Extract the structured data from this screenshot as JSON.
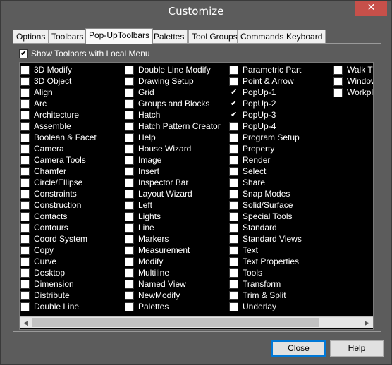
{
  "window": {
    "title": "Customize",
    "close_glyph": "✕"
  },
  "tabs": [
    {
      "label": "Options",
      "key": "O"
    },
    {
      "label": "Toolbars",
      "key": "b"
    },
    {
      "label": "Pop-UpToolbars",
      "key": ""
    },
    {
      "label": "Palettes",
      "key": ""
    },
    {
      "label": "Tool Groups",
      "key": "G"
    },
    {
      "label": "Commands",
      "key": "C"
    },
    {
      "label": "Keyboard",
      "key": "K"
    }
  ],
  "active_tab": "Pop-UpToolbars",
  "show_local_menu": {
    "label": "Show Toolbars with Local Menu",
    "checked": true
  },
  "columns": [
    [
      {
        "label": "3D Modify",
        "checked": false
      },
      {
        "label": "3D Object",
        "checked": false
      },
      {
        "label": "Align",
        "checked": false
      },
      {
        "label": "Arc",
        "checked": false
      },
      {
        "label": "Architecture",
        "checked": false
      },
      {
        "label": "Assemble",
        "checked": false
      },
      {
        "label": "Boolean & Facet",
        "checked": false
      },
      {
        "label": "Camera",
        "checked": false
      },
      {
        "label": "Camera Tools",
        "checked": false
      },
      {
        "label": "Chamfer",
        "checked": false
      },
      {
        "label": "Circle/Ellipse",
        "checked": false
      },
      {
        "label": "Constraints",
        "checked": false
      },
      {
        "label": "Construction",
        "checked": false
      },
      {
        "label": "Contacts",
        "checked": false
      },
      {
        "label": "Contours",
        "checked": false
      },
      {
        "label": "Coord System",
        "checked": false
      },
      {
        "label": "Copy",
        "checked": false
      },
      {
        "label": "Curve",
        "checked": false
      },
      {
        "label": "Desktop",
        "checked": false
      },
      {
        "label": "Dimension",
        "checked": false
      },
      {
        "label": "Distribute",
        "checked": false
      },
      {
        "label": "Double Line",
        "checked": false
      }
    ],
    [
      {
        "label": "Double Line Modify",
        "checked": false
      },
      {
        "label": "Drawing Setup",
        "checked": false
      },
      {
        "label": "Grid",
        "checked": false
      },
      {
        "label": "Groups and Blocks",
        "checked": false
      },
      {
        "label": "Hatch",
        "checked": false
      },
      {
        "label": "Hatch Pattern Creator",
        "checked": false
      },
      {
        "label": "Help",
        "checked": false
      },
      {
        "label": "House Wizard",
        "checked": false
      },
      {
        "label": "Image",
        "checked": false
      },
      {
        "label": "Insert",
        "checked": false
      },
      {
        "label": "Inspector Bar",
        "checked": false
      },
      {
        "label": "Layout Wizard",
        "checked": false
      },
      {
        "label": "Left",
        "checked": false
      },
      {
        "label": "Lights",
        "checked": false
      },
      {
        "label": "Line",
        "checked": false
      },
      {
        "label": "Markers",
        "checked": false
      },
      {
        "label": "Measurement",
        "checked": false
      },
      {
        "label": "Modify",
        "checked": false
      },
      {
        "label": "Multiline",
        "checked": false
      },
      {
        "label": "Named View",
        "checked": false
      },
      {
        "label": "NewModify",
        "checked": false
      },
      {
        "label": "Palettes",
        "checked": false
      }
    ],
    [
      {
        "label": "Parametric Part",
        "checked": false
      },
      {
        "label": "Point & Arrow",
        "checked": false
      },
      {
        "label": "PopUp-1",
        "checked": true
      },
      {
        "label": "PopUp-2",
        "checked": true
      },
      {
        "label": "PopUp-3",
        "checked": true
      },
      {
        "label": "PopUp-4",
        "checked": false
      },
      {
        "label": "Program Setup",
        "checked": false
      },
      {
        "label": "Property",
        "checked": false
      },
      {
        "label": "Render",
        "checked": false
      },
      {
        "label": "Select",
        "checked": false
      },
      {
        "label": "Share",
        "checked": false
      },
      {
        "label": "Snap Modes",
        "checked": false
      },
      {
        "label": "Solid/Surface",
        "checked": false
      },
      {
        "label": "Special Tools",
        "checked": false
      },
      {
        "label": "Standard",
        "checked": false
      },
      {
        "label": "Standard Views",
        "checked": false
      },
      {
        "label": "Text",
        "checked": false
      },
      {
        "label": "Text Properties",
        "checked": false
      },
      {
        "label": "Tools",
        "checked": false
      },
      {
        "label": "Transform",
        "checked": false
      },
      {
        "label": "Trim & Split",
        "checked": false
      },
      {
        "label": "Underlay",
        "checked": false
      }
    ],
    [
      {
        "label": "Walk Th",
        "checked": false
      },
      {
        "label": "Window",
        "checked": false
      },
      {
        "label": "Workpla",
        "checked": false
      }
    ]
  ],
  "scrollbar": {
    "left_glyph": "◀",
    "right_glyph": "▶"
  },
  "buttons": {
    "close": "Close",
    "help": "Help"
  }
}
